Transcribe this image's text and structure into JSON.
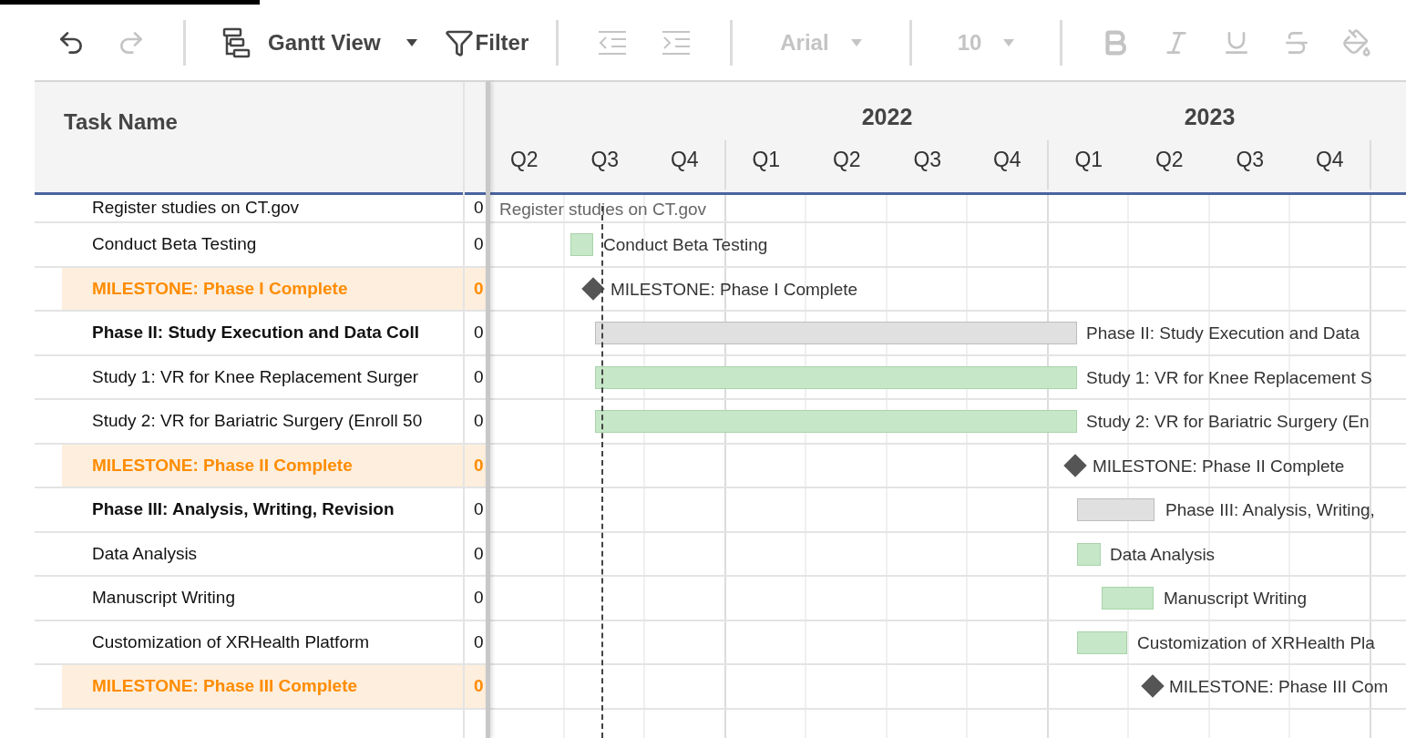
{
  "toolbar": {
    "items": [
      {
        "kind": "undo",
        "disabled": false
      },
      {
        "kind": "redo",
        "disabled": true
      },
      {
        "kind": "divider"
      },
      {
        "kind": "view",
        "label": "Gantt View"
      },
      {
        "kind": "filter",
        "label": "Filter"
      },
      {
        "kind": "divider"
      },
      {
        "kind": "outdent",
        "disabled": true
      },
      {
        "kind": "indent",
        "disabled": true
      },
      {
        "kind": "divider"
      },
      {
        "kind": "font",
        "label": "Arial",
        "disabled": true
      },
      {
        "kind": "divider"
      },
      {
        "kind": "size",
        "label": "10",
        "disabled": true
      },
      {
        "kind": "divider"
      },
      {
        "kind": "bold",
        "disabled": true
      },
      {
        "kind": "italic",
        "disabled": true
      },
      {
        "kind": "underline",
        "disabled": true
      },
      {
        "kind": "strike",
        "disabled": true
      },
      {
        "kind": "fill",
        "disabled": true
      }
    ]
  },
  "grid": {
    "columns": [
      {
        "label": "Task Name"
      }
    ],
    "years": [
      {
        "label": "2022"
      },
      {
        "label": "2023"
      }
    ],
    "quarters": [
      "Q2",
      "Q3",
      "Q4",
      "Q1",
      "Q2",
      "Q3",
      "Q4",
      "Q1",
      "Q2",
      "Q3",
      "Q4"
    ],
    "rows": [
      {
        "kind": "task",
        "name": "Register studies on CT.gov",
        "value": "0",
        "bar_label": "Register studies on CT.gov"
      },
      {
        "kind": "task",
        "name": "Conduct Beta Testing",
        "value": "0",
        "bar_label": "Conduct Beta Testing"
      },
      {
        "kind": "milestone",
        "name": "MILESTONE: Phase I Complete",
        "value": "0",
        "bar_label": "MILESTONE: Phase I Complete"
      },
      {
        "kind": "phase",
        "name": "Phase II: Study Execution and Data Coll",
        "value": "0",
        "bar_label": "Phase II: Study Execution and Data"
      },
      {
        "kind": "task",
        "name": "Study 1: VR for Knee Replacement Surger",
        "value": "0",
        "bar_label": "Study 1: VR for Knee Replacement S"
      },
      {
        "kind": "task",
        "name": "Study 2: VR for Bariatric Surgery (Enroll 50",
        "value": "0",
        "bar_label": "Study 2: VR for Bariatric Surgery (En"
      },
      {
        "kind": "milestone",
        "name": "MILESTONE: Phase II Complete",
        "value": "0",
        "bar_label": "MILESTONE: Phase II Complete"
      },
      {
        "kind": "phase",
        "name": "Phase III: Analysis, Writing, Revision",
        "value": "0",
        "bar_label": "Phase III: Analysis, Writing,"
      },
      {
        "kind": "task",
        "name": "Data Analysis",
        "value": "0",
        "bar_label": "Data Analysis"
      },
      {
        "kind": "task",
        "name": "Manuscript Writing",
        "value": "0",
        "bar_label": "Manuscript Writing"
      },
      {
        "kind": "task",
        "name": "Customization of XRHealth Platform",
        "value": "0",
        "bar_label": "Customization of XRHealth Pla"
      },
      {
        "kind": "milestone",
        "name": "MILESTONE: Phase III Complete",
        "value": "0",
        "bar_label": "MILESTONE: Phase III Com"
      }
    ]
  }
}
